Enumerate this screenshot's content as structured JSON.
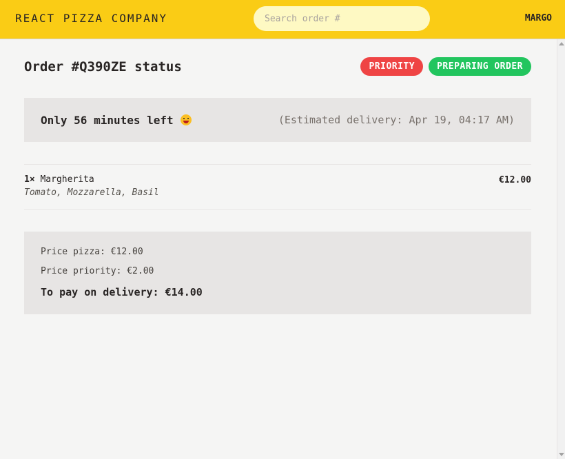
{
  "header": {
    "logo": "REACT PIZZA COMPANY",
    "search_placeholder": "Search order #",
    "username": "MARGO"
  },
  "order": {
    "title": "Order #Q390ZE status",
    "badges": {
      "priority": "PRIORITY",
      "status": "PREPARING ORDER"
    },
    "time_left": "Only 56 minutes left",
    "time_left_icon": "grinning-face-emoji",
    "estimated_delivery": "(Estimated delivery: Apr 19, 04:17 AM)"
  },
  "items": [
    {
      "quantity": "1×",
      "name": "Margherita",
      "price": "€12.00",
      "ingredients": "Tomato, Mozzarella, Basil"
    }
  ],
  "summary": {
    "price_pizza": "Price pizza: €12.00",
    "price_priority": "Price priority: €2.00",
    "to_pay": "To pay on delivery: €14.00"
  },
  "colors": {
    "header_bg": "#facc15",
    "priority_badge": "#ef4444",
    "status_badge": "#22c55e",
    "panel_bg": "#e7e5e4"
  }
}
